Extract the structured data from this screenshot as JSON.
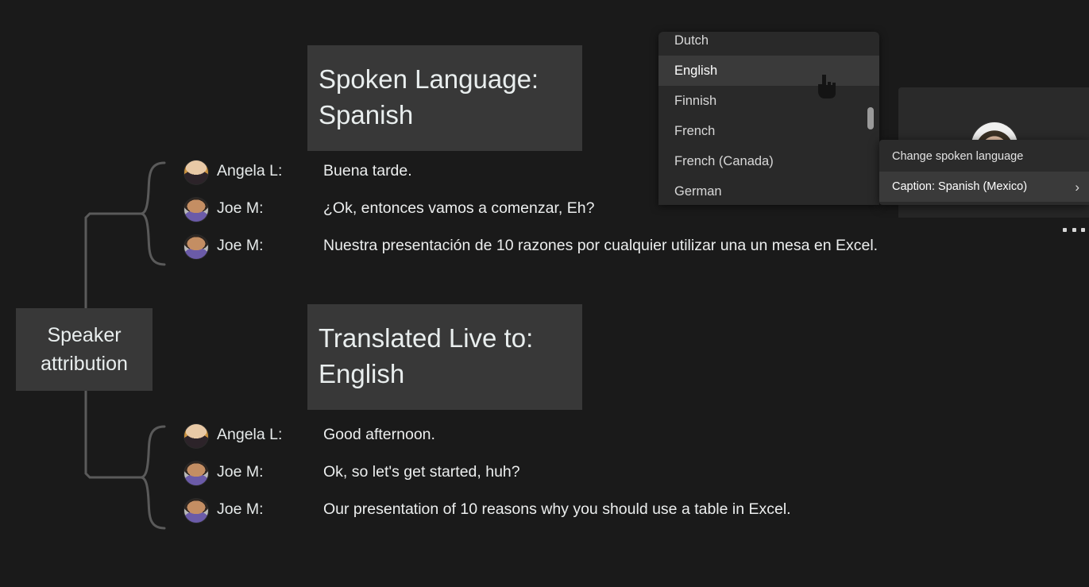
{
  "meeting": {
    "video_tile_name": "participant-video-tile",
    "more_options_label": "More options"
  },
  "language_dropdown": {
    "name": "spoken-language-dropdown",
    "selected": "English",
    "items": [
      {
        "label": "Dutch",
        "selected": false,
        "clipped": true
      },
      {
        "label": "English",
        "selected": true,
        "clipped": false
      },
      {
        "label": "Finnish",
        "selected": false,
        "clipped": false
      },
      {
        "label": "French",
        "selected": false,
        "clipped": false
      },
      {
        "label": "French (Canada)",
        "selected": false,
        "clipped": false
      },
      {
        "label": "German",
        "selected": false,
        "clipped": false
      }
    ]
  },
  "caption_menu": {
    "items": [
      {
        "label": "Change spoken language",
        "highlighted": false,
        "chevron": ""
      },
      {
        "label": "Caption: Spanish (Mexico)",
        "highlighted": true,
        "chevron": "›"
      }
    ]
  },
  "callouts": {
    "spoken_language": {
      "line1": "Spoken Language:",
      "line2": "Spanish"
    },
    "translated_live": {
      "line1": "Translated Live to:",
      "line2": "English"
    },
    "speaker_attribution": {
      "line1": "Speaker",
      "line2": "attribution"
    }
  },
  "transcript_spanish": [
    {
      "speaker": "Angela L:",
      "avatar": "angela",
      "text": "Buena tarde."
    },
    {
      "speaker": "Joe M:",
      "avatar": "joe",
      "text": "¿Ok, entonces vamos a comenzar, Eh?"
    },
    {
      "speaker": "Joe M:",
      "avatar": "joe",
      "text": "Nuestra presentación de 10 razones por cualquier utilizar una un mesa en Excel."
    }
  ],
  "transcript_english": [
    {
      "speaker": "Angela L:",
      "avatar": "angela",
      "text": "Good afternoon."
    },
    {
      "speaker": "Joe M:",
      "avatar": "joe",
      "text": "Ok, so let's get started, huh?"
    },
    {
      "speaker": "Joe M:",
      "avatar": "joe",
      "text": "Our presentation of 10 reasons why you should use a table in Excel."
    }
  ],
  "colors": {
    "background": "#1a1a1a",
    "callout_bg": "#383838",
    "menu_bg": "#2b2b2b",
    "dropdown_bg": "#292929",
    "highlight": "#3a3a3a",
    "text": "#eceeee",
    "annotation_line": "#5a5a5a",
    "scrollbar_thumb": "#9a9a9a"
  }
}
